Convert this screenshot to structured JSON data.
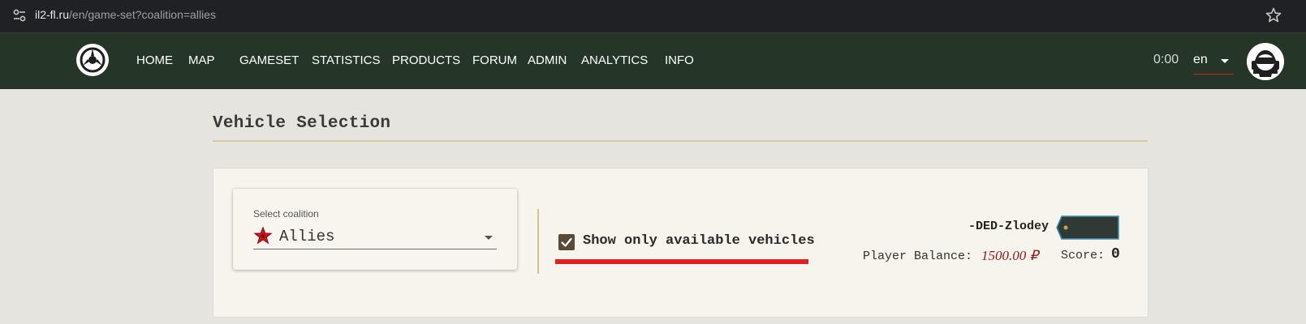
{
  "browser": {
    "url_domain": "il2-fl.ru",
    "url_path": "/en/game-set?coalition=allies"
  },
  "navbar": {
    "links": [
      "HOME",
      "MAP",
      "GAMESET",
      "STATISTICS",
      "PRODUCTS",
      "FORUM",
      "ADMIN",
      "ANALYTICS",
      "INFO"
    ],
    "clock": "0:00",
    "language": "en"
  },
  "page": {
    "title": "Vehicle Selection"
  },
  "coalition_select": {
    "label": "Select coalition",
    "value": "Allies",
    "icon": "red-star-icon"
  },
  "filter": {
    "checked": true,
    "label": "Show only available vehicles"
  },
  "player": {
    "name": "-DED-Zlodey",
    "balance_label": "Player Balance:",
    "balance_value": "1500.00 ₽",
    "score_label": "Score:",
    "score_value": "0"
  },
  "colors": {
    "navbar_bg": "#253629",
    "accent_red": "#dd2026",
    "checkbox_fill": "#5a4a35",
    "balance_red": "#8b1a1a",
    "rule_gold": "#d9c79b"
  }
}
